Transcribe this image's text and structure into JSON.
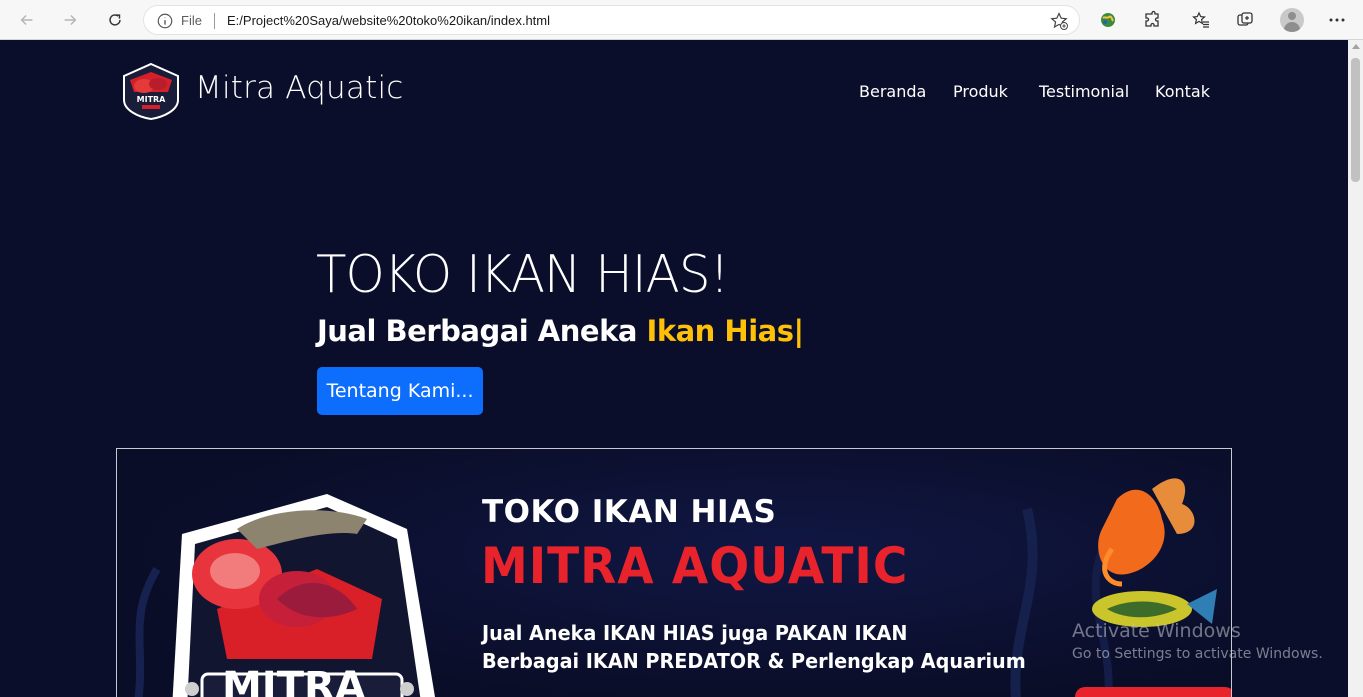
{
  "browser": {
    "scheme_label": "File",
    "url": "E:/Project%20Saya/website%20toko%20ikan/index.html"
  },
  "navbar": {
    "brand": "Mitra Aquatic",
    "links": [
      "Beranda",
      "Produk",
      "Testimonial",
      "Kontak"
    ]
  },
  "hero": {
    "title": "TOKO IKAN HIAS!",
    "subtitle_prefix": "Jual Berbagai Aneka ",
    "subtitle_highlight": "Ikan Hias|",
    "button": "Tentang Kami..."
  },
  "banner": {
    "title_small": "TOKO IKAN HIAS",
    "title_big": "MITRA AQUATIC",
    "line1": "Jual Aneka IKAN HIAS juga PAKAN IKAN",
    "line2": "Berbagai IKAN PREDATOR & Perlengkap Aquarium",
    "logo_text": "MITRA"
  },
  "logo_text": "MITRA",
  "watermark": {
    "line1": "Activate Windows",
    "line2": "Go to Settings to activate Windows."
  },
  "colors": {
    "page_bg": "#0b0e2a",
    "highlight": "#ffc107",
    "button": "#0d6efd",
    "banner_red": "#e8232b"
  }
}
